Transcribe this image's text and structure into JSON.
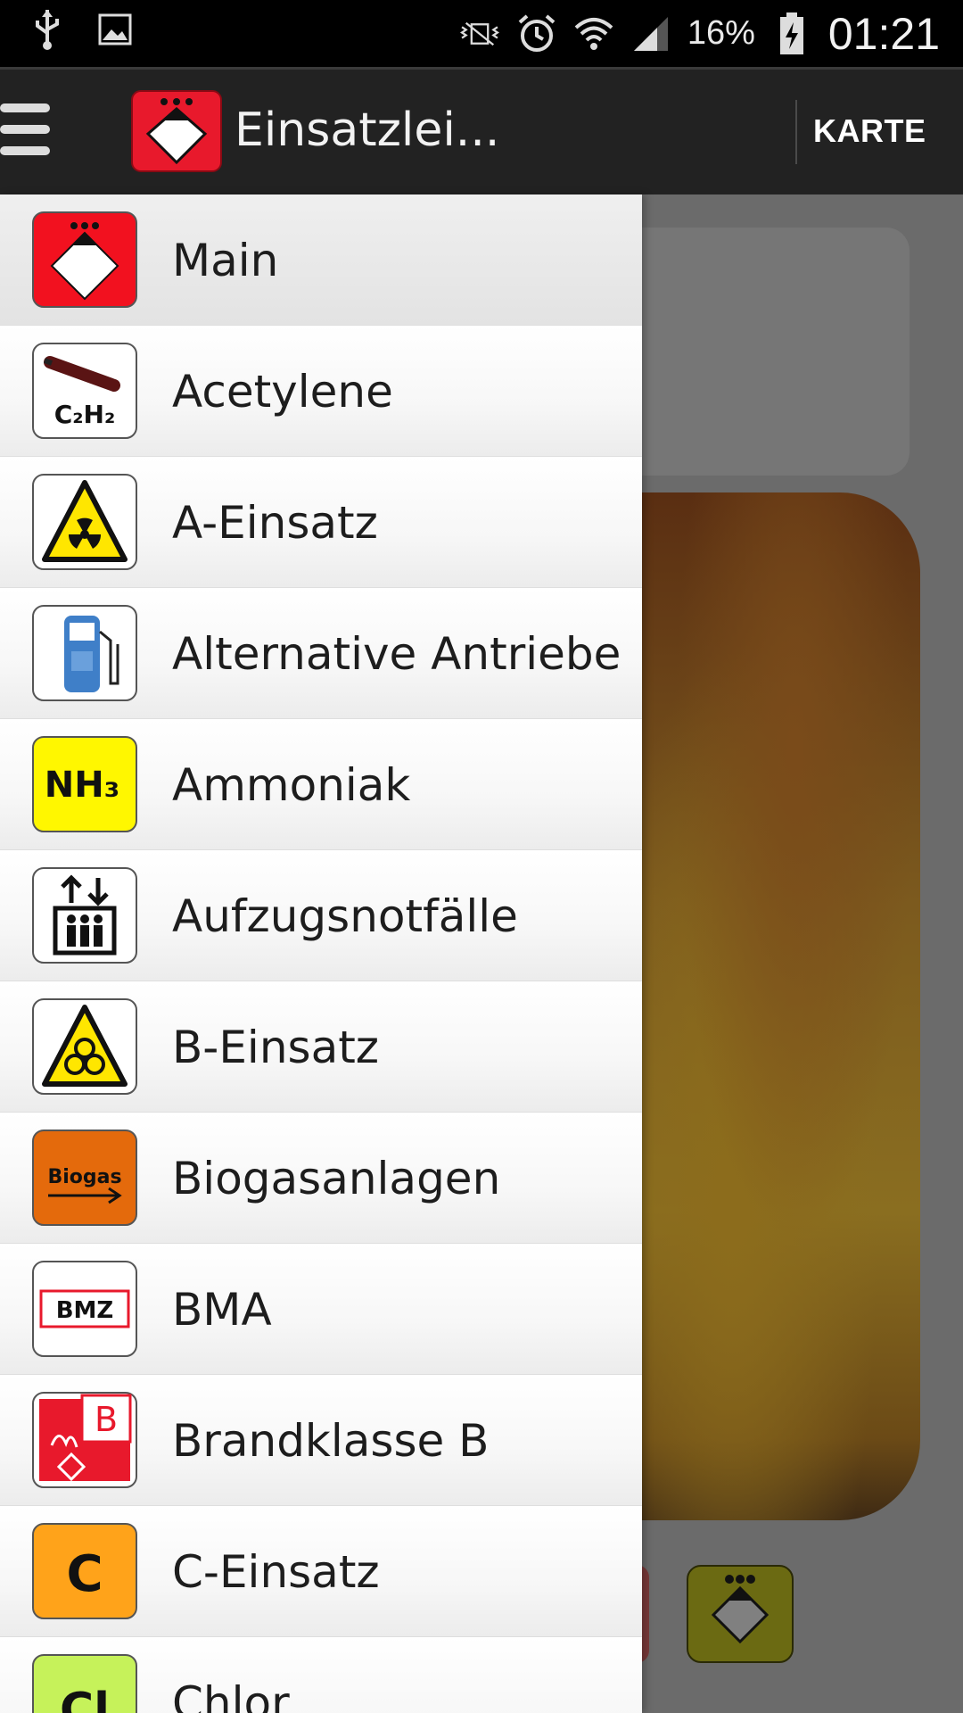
{
  "status_bar": {
    "battery_percent": "16%",
    "time": "01:21",
    "icons": [
      "usb-icon",
      "image-icon",
      "mute-vibrate-icon",
      "alarm-icon",
      "wifi-icon",
      "signal-icon",
      "battery-charging-icon"
    ]
  },
  "action_bar": {
    "title": "Einsatzlei...",
    "action_label": "KARTE"
  },
  "drawer": {
    "items": [
      {
        "label": "Main",
        "icon": "hazard-diamond-icon"
      },
      {
        "label": "Acetylene",
        "icon": "gas-cylinder-icon",
        "icon_text": "C₂H₂"
      },
      {
        "label": "A-Einsatz",
        "icon": "radiation-icon"
      },
      {
        "label": "Alternative Antriebe",
        "icon": "fuel-pump-icon"
      },
      {
        "label": "Ammoniak",
        "icon": "ammonia-icon",
        "icon_text": "NH₃"
      },
      {
        "label": "Aufzugsnotfälle",
        "icon": "elevator-icon"
      },
      {
        "label": "B-Einsatz",
        "icon": "biohazard-icon"
      },
      {
        "label": "Biogasanlagen",
        "icon": "biogas-icon",
        "icon_text": "Biogas"
      },
      {
        "label": "BMA",
        "icon": "bmz-icon",
        "icon_text": "BMZ"
      },
      {
        "label": "Brandklasse B",
        "icon": "fire-class-b-icon",
        "icon_text": "B"
      },
      {
        "label": "C-Einsatz",
        "icon": "chemical-c-icon",
        "icon_text": "C"
      },
      {
        "label": "Chlor",
        "icon": "chlorine-icon",
        "icon_text": "Cl"
      }
    ]
  },
  "colors": {
    "accent_red": "#e8192c",
    "action_bar": "#222222",
    "status_bar": "#000000"
  }
}
